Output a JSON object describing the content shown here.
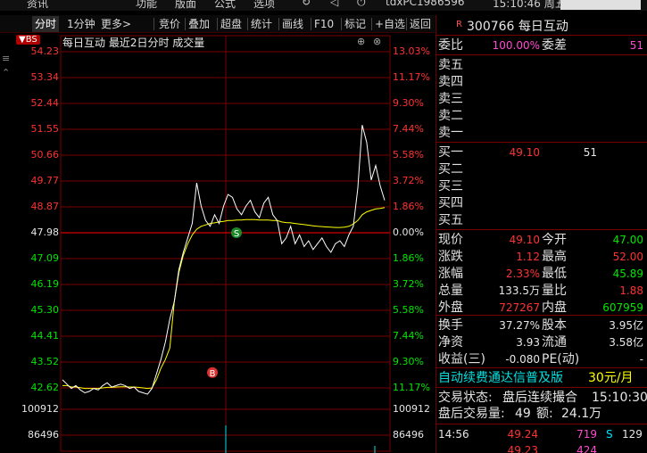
{
  "menu": {
    "items": [
      "资讯",
      "功能",
      "版面",
      "公式",
      "选项",
      "tdxPC1986596",
      "15:10:46 周五"
    ]
  },
  "toolbar": {
    "items": [
      {
        "label": "分时",
        "active": true
      },
      {
        "label": "1分钟",
        "active": false
      },
      {
        "label": "更多>",
        "active": false
      },
      {
        "label": "竞价",
        "active": false
      },
      {
        "label": "叠加",
        "active": false
      },
      {
        "label": "超盘",
        "active": false
      },
      {
        "label": "统计",
        "active": false
      },
      {
        "label": "画线",
        "active": false
      },
      {
        "label": "F10",
        "active": false
      },
      {
        "label": "标记",
        "active": false
      },
      {
        "label": "+自选",
        "active": false
      },
      {
        "label": "返回",
        "active": false
      }
    ]
  },
  "chart": {
    "bs_badge": "BS",
    "title": "每日互动   最近2日分时 成交量",
    "marker_s": "S",
    "marker_b": "B",
    "colors": {
      "price": "#ffffff",
      "avg": "#ffff00",
      "up": "#ff3232",
      "down": "#00e600",
      "grid": "#7a0000",
      "volume": "#00e0e0"
    }
  },
  "chart_data": {
    "type": "line",
    "title": "每日互动   最近2日分时 成交量",
    "prev_close": 47.98,
    "price_ticks": [
      "54.23",
      "53.34",
      "52.44",
      "51.55",
      "50.66",
      "49.77",
      "48.87",
      "47.98",
      "47.09",
      "46.19",
      "45.30",
      "44.41",
      "43.52",
      "42.62"
    ],
    "pct_ticks": [
      "13.03%",
      "11.17%",
      "9.30%",
      "7.44%",
      "5.58%",
      "3.72%",
      "1.86%",
      "0.00%",
      "1.86%",
      "3.72%",
      "5.58%",
      "7.44%",
      "9.30%",
      "11.17%"
    ],
    "volume_ticks": [
      "100912",
      "86496"
    ],
    "ylim": [
      42.62,
      54.23
    ],
    "series": [
      {
        "role": "price",
        "values": [
          42.9,
          42.75,
          42.6,
          42.7,
          42.55,
          42.45,
          42.5,
          42.6,
          42.55,
          42.7,
          42.8,
          42.65,
          42.7,
          42.75,
          42.7,
          42.6,
          42.65,
          42.5,
          42.45,
          42.4,
          42.6,
          43.1,
          43.6,
          44.2,
          45.0,
          45.6,
          46.7,
          47.3,
          47.8,
          48.3,
          49.7,
          48.9,
          48.4,
          48.2,
          48.6,
          48.3,
          48.9,
          49.3,
          49.2,
          48.8,
          48.6,
          48.9,
          49.1,
          48.7,
          48.5,
          49.0,
          49.2,
          48.6,
          48.4,
          47.6,
          47.8,
          48.2,
          47.6,
          47.9,
          47.5,
          47.7,
          47.4,
          47.6,
          47.8,
          47.5,
          47.3,
          47.6,
          47.7,
          47.5,
          47.9,
          48.2,
          49.5,
          51.7,
          51.1,
          49.8,
          50.3,
          49.6,
          49.1
        ]
      },
      {
        "role": "avg",
        "values": [
          42.7,
          42.7,
          42.65,
          42.65,
          42.63,
          42.6,
          42.6,
          42.6,
          42.6,
          42.62,
          42.64,
          42.64,
          42.65,
          42.66,
          42.66,
          42.65,
          42.65,
          42.64,
          42.62,
          42.6,
          42.62,
          42.9,
          43.3,
          43.6,
          44.0,
          45.6,
          46.6,
          47.2,
          47.6,
          47.9,
          48.1,
          48.2,
          48.25,
          48.3,
          48.32,
          48.35,
          48.37,
          48.4,
          48.4,
          48.42,
          48.42,
          48.43,
          48.43,
          48.43,
          48.42,
          48.42,
          48.42,
          48.4,
          48.4,
          48.35,
          48.33,
          48.32,
          48.3,
          48.28,
          48.26,
          48.24,
          48.22,
          48.2,
          48.19,
          48.18,
          48.17,
          48.16,
          48.16,
          48.17,
          48.2,
          48.28,
          48.4,
          48.6,
          48.7,
          48.75,
          48.8,
          48.82,
          48.85
        ]
      }
    ]
  },
  "quote": {
    "code_name": "300766 每日互动",
    "r_badge": "R",
    "weibi_label": "委比",
    "weibi_value": "100.00%",
    "weicha_label": "委差",
    "weicha_value": "51",
    "sells": [
      {
        "label": "卖五"
      },
      {
        "label": "卖四"
      },
      {
        "label": "卖三"
      },
      {
        "label": "卖二"
      },
      {
        "label": "卖一"
      }
    ],
    "buys": [
      {
        "label": "买一",
        "price": "49.10",
        "vol": "51"
      },
      {
        "label": "买二",
        "price": "",
        "vol": ""
      },
      {
        "label": "买三",
        "price": "",
        "vol": ""
      },
      {
        "label": "买四",
        "price": "",
        "vol": ""
      },
      {
        "label": "买五",
        "price": "",
        "vol": ""
      }
    ],
    "stats": [
      {
        "l1": "现价",
        "v1": "49.10",
        "c1": "red",
        "l2": "今开",
        "v2": "47.00",
        "c2": "green"
      },
      {
        "l1": "涨跌",
        "v1": "1.12",
        "c1": "red",
        "l2": "最高",
        "v2": "52.00",
        "c2": "red"
      },
      {
        "l1": "涨幅",
        "v1": "2.33%",
        "c1": "red",
        "l2": "最低",
        "v2": "45.89",
        "c2": "green"
      },
      {
        "l1": "总量",
        "v1": "133.5万",
        "c1": "white",
        "l2": "量比",
        "v2": "1.88",
        "c2": "red"
      },
      {
        "l1": "外盘",
        "v1": "727267",
        "c1": "red",
        "l2": "内盘",
        "v2": "607959",
        "c2": "green"
      }
    ],
    "finance": [
      {
        "l1": "换手",
        "v1": "37.27%",
        "l2": "股本",
        "v2": "3.95亿"
      },
      {
        "l1": "净资",
        "v1": "3.93",
        "l2": "流通",
        "v2": "3.58亿"
      },
      {
        "l1": "收益(三)",
        "v1": "-0.080",
        "l2": "PE(动)",
        "v2": "-"
      }
    ],
    "ad": {
      "text": "自动续费通达信普及版",
      "price": "30元/月"
    },
    "status": {
      "label": "交易状态:",
      "value": "盘后连续撮合",
      "time": "15:10:30"
    },
    "after_hours": {
      "label": "盘后交易量:",
      "vol": "49",
      "amount_label": "额:",
      "amount": "24.1万"
    },
    "ticks": [
      {
        "time": "14:56",
        "price": "49.24",
        "vol": "719",
        "side": "S",
        "num": "129"
      },
      {
        "time": "",
        "price": "49.23",
        "vol": "424",
        "side": "",
        "num": ""
      }
    ]
  }
}
